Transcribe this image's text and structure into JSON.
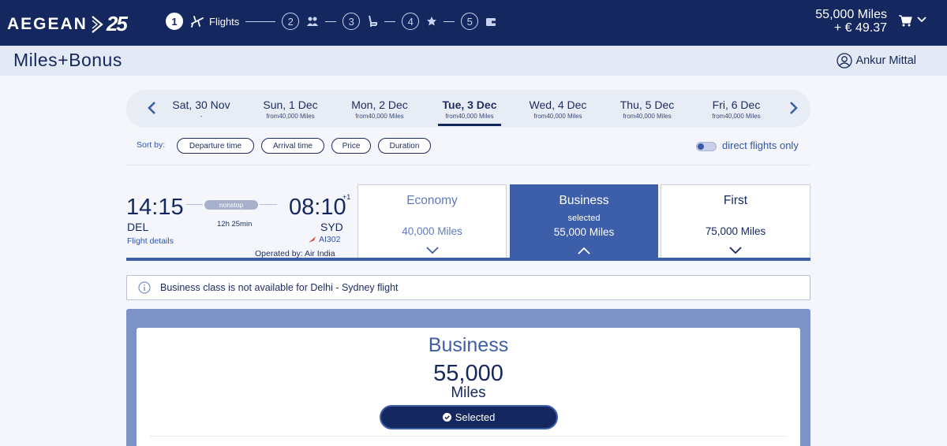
{
  "header": {
    "brand": "AEGEAN",
    "anniversary": "25",
    "steps": [
      {
        "number": "1",
        "label": "Flights",
        "icon": "plane-icon",
        "active": true
      },
      {
        "number": "2",
        "label": "",
        "icon": "passengers-icon",
        "active": false
      },
      {
        "number": "3",
        "label": "",
        "icon": "seat-icon",
        "active": false
      },
      {
        "number": "4",
        "label": "",
        "icon": "star-icon",
        "active": false
      },
      {
        "number": "5",
        "label": "",
        "icon": "wallet-icon",
        "active": false
      }
    ],
    "cart_miles": "55,000 Miles",
    "cart_price": "+ € 49.37"
  },
  "subheader": {
    "program": "Miles+Bonus",
    "user_name": "Ankur Mittal"
  },
  "dates": [
    {
      "label": "Sat, 30 Nov",
      "sub": "-"
    },
    {
      "label": "Sun, 1 Dec",
      "sub": "from40,000 Miles"
    },
    {
      "label": "Mon, 2 Dec",
      "sub": "from40,000 Miles"
    },
    {
      "label": "Tue, 3 Dec",
      "sub": "from40,000 Miles",
      "active": true
    },
    {
      "label": "Wed, 4 Dec",
      "sub": "from40,000 Miles"
    },
    {
      "label": "Thu, 5 Dec",
      "sub": "from40,000 Miles"
    },
    {
      "label": "Fri, 6 Dec",
      "sub": "from40,000 Miles"
    }
  ],
  "sort": {
    "label": "Sort by:",
    "options": [
      "Departure time",
      "Arrival time",
      "Price",
      "Duration"
    ],
    "direct_only_label": "direct flights only",
    "direct_only_enabled": false
  },
  "flight": {
    "departure_time": "14:15",
    "departure_code": "DEL",
    "details_link": "Flight details",
    "stops": "nonstop",
    "duration": "12h 25min",
    "arrival_time": "08:10",
    "day_offset": "+1",
    "arrival_code": "SYD",
    "flight_number": "AI302",
    "operated_by": "Operated by: Air India"
  },
  "fares": {
    "economy": {
      "name": "Economy",
      "miles": "40,000 Miles"
    },
    "business": {
      "name": "Business",
      "status": "selected",
      "miles": "55,000 Miles"
    },
    "first": {
      "name": "First",
      "miles": "75,000 Miles"
    }
  },
  "notice": {
    "text": "Business class is not available for Delhi - Sydney flight"
  },
  "selected_fare": {
    "name": "Business",
    "miles": "55,000",
    "unit": "Miles",
    "button_label": "Selected"
  },
  "colors": {
    "navy": "#14285f",
    "accent_blue": "#3d5ea8",
    "panel_blue": "#7d92c6"
  }
}
